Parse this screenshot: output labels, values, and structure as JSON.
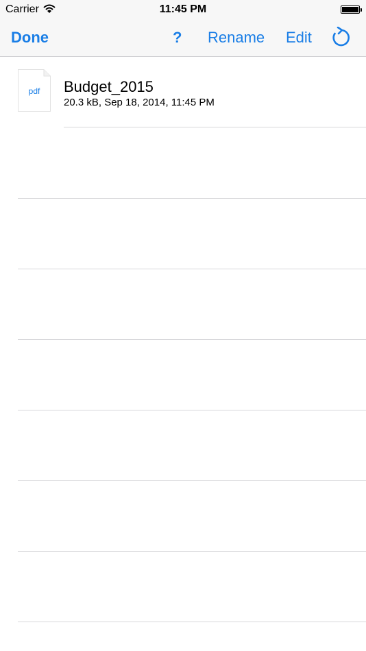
{
  "status_bar": {
    "carrier": "Carrier",
    "time": "11:45 PM",
    "battery_level": 1.0
  },
  "nav": {
    "done": "Done",
    "help": "?",
    "rename": "Rename",
    "edit": "Edit",
    "refresh_icon": "refresh-icon"
  },
  "files": [
    {
      "name": "Budget_2015",
      "meta": "20.3 kB, Sep 18, 2014, 11:45 PM",
      "type_label": "pdf",
      "icon": "pdf-file-icon"
    }
  ],
  "colors": {
    "accent": "#1a7ee6",
    "bar_background": "#f7f7f7",
    "separator": "#d6d6d9"
  }
}
